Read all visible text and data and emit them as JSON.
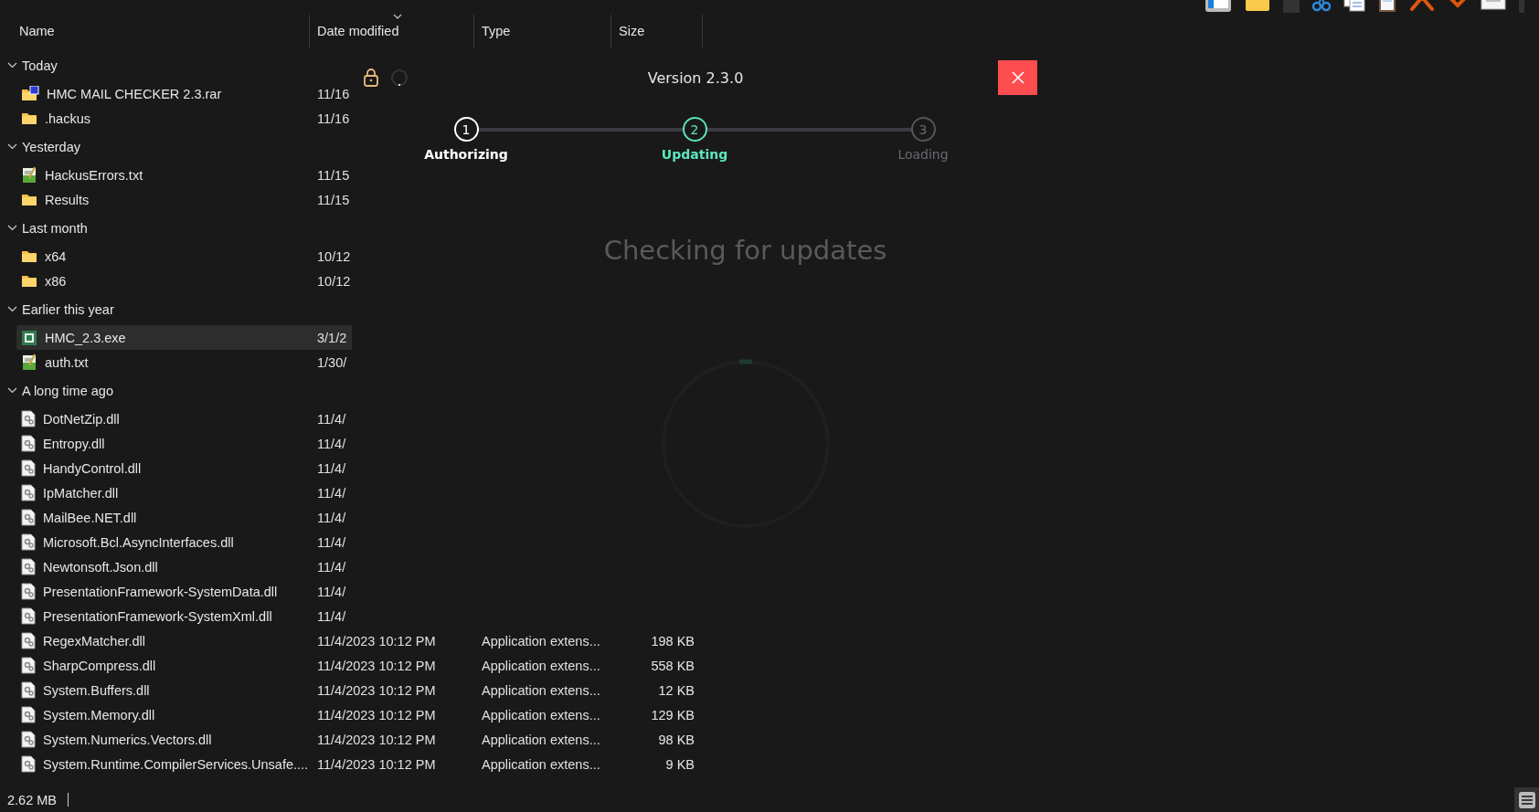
{
  "columns": [
    {
      "label": "Name",
      "sorted": false
    },
    {
      "label": "Date modified",
      "sorted": true
    },
    {
      "label": "Type",
      "sorted": false
    },
    {
      "label": "Size",
      "sorted": false
    }
  ],
  "groups": [
    {
      "label": "Today",
      "expanded": true,
      "items": [
        {
          "name": "HMC MAIL CHECKER 2.3.rar",
          "kind": "archive",
          "date": "11/16",
          "selected": false
        },
        {
          "name": ".hackus",
          "kind": "folder",
          "date": "11/16",
          "selected": false
        }
      ]
    },
    {
      "label": "Yesterday",
      "expanded": true,
      "items": [
        {
          "name": "HackusErrors.txt",
          "kind": "text",
          "date": "11/15",
          "selected": false
        },
        {
          "name": "Results",
          "kind": "folder",
          "date": "11/15",
          "selected": false
        }
      ]
    },
    {
      "label": "Last month",
      "expanded": true,
      "items": [
        {
          "name": "x64",
          "kind": "folder",
          "date": "10/12",
          "selected": false
        },
        {
          "name": "x86",
          "kind": "folder",
          "date": "10/12",
          "selected": false
        }
      ]
    },
    {
      "label": "Earlier this year",
      "expanded": true,
      "items": [
        {
          "name": "HMC_2.3.exe",
          "kind": "app",
          "date": "3/1/2",
          "selected": true
        },
        {
          "name": "auth.txt",
          "kind": "text",
          "date": "1/30/",
          "selected": false
        }
      ]
    },
    {
      "label": "A long time ago",
      "expanded": true,
      "items": [
        {
          "name": "DotNetZip.dll",
          "kind": "library",
          "date": "11/4/",
          "selected": false
        },
        {
          "name": "Entropy.dll",
          "kind": "library",
          "date": "11/4/",
          "selected": false
        },
        {
          "name": "HandyControl.dll",
          "kind": "library",
          "date": "11/4/",
          "selected": false
        },
        {
          "name": "IpMatcher.dll",
          "kind": "library",
          "date": "11/4/",
          "selected": false
        },
        {
          "name": "MailBee.NET.dll",
          "kind": "library",
          "date": "11/4/",
          "selected": false
        },
        {
          "name": "Microsoft.Bcl.AsyncInterfaces.dll",
          "kind": "library",
          "date": "11/4/",
          "selected": false
        },
        {
          "name": "Newtonsoft.Json.dll",
          "kind": "library",
          "date": "11/4/",
          "selected": false
        },
        {
          "name": "PresentationFramework-SystemData.dll",
          "kind": "library",
          "date": "11/4/",
          "selected": false
        },
        {
          "name": "PresentationFramework-SystemXml.dll",
          "kind": "library",
          "date": "11/4/",
          "selected": false
        },
        {
          "name": "RegexMatcher.dll",
          "kind": "library",
          "date": "11/4/2023 10:12 PM",
          "type": "Application extens...",
          "size": "198 KB",
          "selected": false
        },
        {
          "name": "SharpCompress.dll",
          "kind": "library",
          "date": "11/4/2023 10:12 PM",
          "type": "Application extens...",
          "size": "558 KB",
          "selected": false
        },
        {
          "name": "System.Buffers.dll",
          "kind": "library",
          "date": "11/4/2023 10:12 PM",
          "type": "Application extens...",
          "size": "12 KB",
          "selected": false
        },
        {
          "name": "System.Memory.dll",
          "kind": "library",
          "date": "11/4/2023 10:12 PM",
          "type": "Application extens...",
          "size": "129 KB",
          "selected": false
        },
        {
          "name": "System.Numerics.Vectors.dll",
          "kind": "library",
          "date": "11/4/2023 10:12 PM",
          "type": "Application extens...",
          "size": "98 KB",
          "selected": false
        },
        {
          "name": "System.Runtime.CompilerServices.Unsafe....",
          "kind": "library",
          "date": "11/4/2023 10:12 PM",
          "type": "Application extens...",
          "size": "9 KB",
          "selected": false
        }
      ]
    }
  ],
  "status_bar": {
    "size": "2.62 MB"
  },
  "dialog": {
    "title": "Version 2.3.0",
    "steps": [
      {
        "number": "1",
        "label": "Authorizing",
        "kind": "done"
      },
      {
        "number": "2",
        "label": "Updating",
        "kind": "active"
      },
      {
        "number": "3",
        "label": "Loading",
        "kind": "pending"
      }
    ],
    "message": "Checking for updates"
  }
}
